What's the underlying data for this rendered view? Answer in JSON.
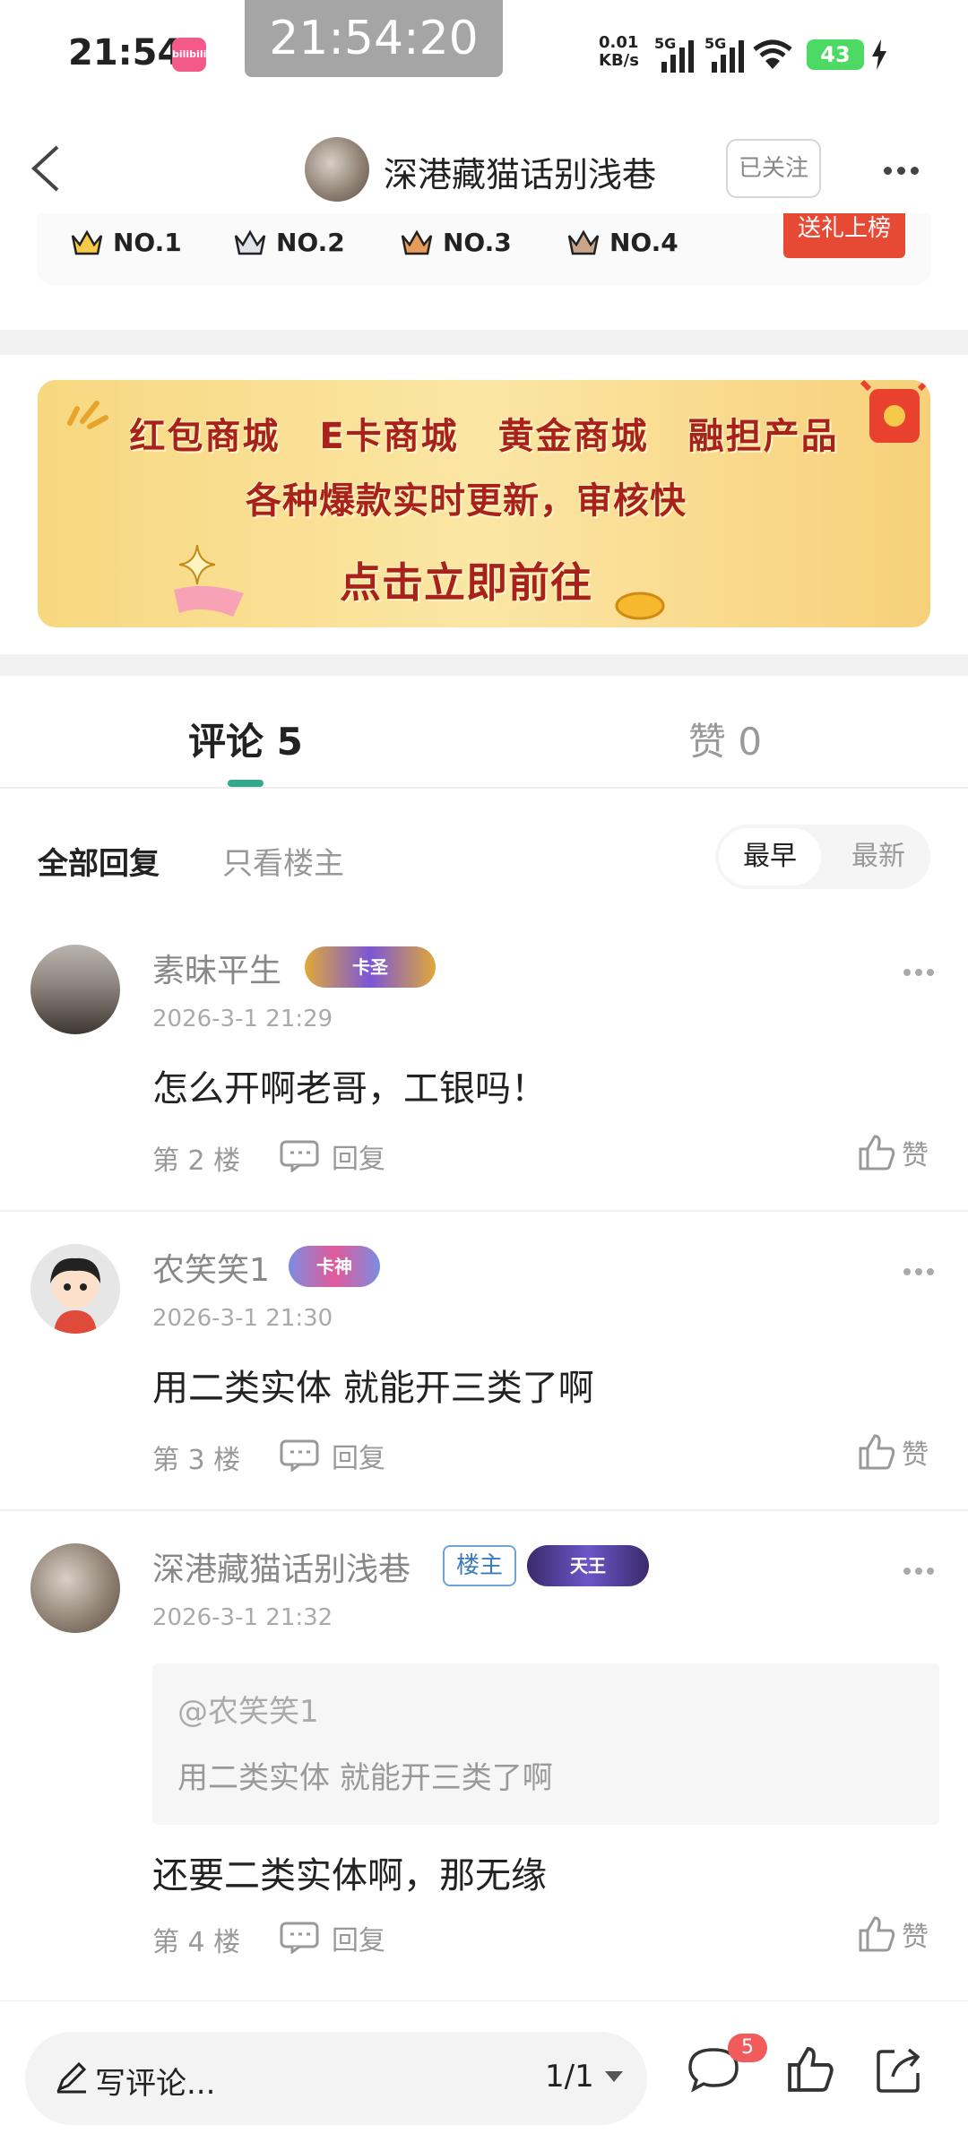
{
  "status_bar": {
    "time": "21:54",
    "app_icon_label": "bilibili",
    "overlay_clock": "21:54:20",
    "net_speed_value": "0.01",
    "net_speed_unit": "KB/s",
    "signal1_gen": "5G",
    "signal2_gen": "5G",
    "battery": "43"
  },
  "header": {
    "title": "深港藏猫话别浅巷",
    "follow_label": "已关注"
  },
  "ranking": {
    "items": [
      "NO.1",
      "NO.2",
      "NO.3",
      "NO.4"
    ],
    "gift_button": "送礼上榜"
  },
  "banner": {
    "row1": [
      "红包商城",
      "E卡商城",
      "黄金商城",
      "融担产品"
    ],
    "row2": "各种爆款实时更新，审核快",
    "row3": "点击立即前往"
  },
  "tabs": {
    "comments": "评论 5",
    "likes": "赞 0"
  },
  "filters": {
    "all": "全部回复",
    "op_only": "只看楼主",
    "sort_earliest": "最早",
    "sort_newest": "最新"
  },
  "comments": [
    {
      "name": "素昧平生",
      "badge": "卡圣",
      "time": "2026-3-1 21:29",
      "text": "怎么开啊老哥，工银吗！",
      "floor": "第 2 楼",
      "reply": "回复",
      "like": "赞"
    },
    {
      "name": "农笑笑1",
      "badge": "卡神",
      "time": "2026-3-1 21:30",
      "text": "用二类实体 就能开三类了啊",
      "floor": "第 3 楼",
      "reply": "回复",
      "like": "赞"
    },
    {
      "name": "深港藏猫话别浅巷",
      "op_tag": "楼主",
      "badge": "天王",
      "time": "2026-3-1 21:32",
      "quote_user": "@农笑笑1",
      "quote_text": "用二类实体 就能开三类了啊",
      "text": "还要二类实体啊，那无缘",
      "floor": "第 4 楼",
      "reply": "回复",
      "like": "赞"
    }
  ],
  "bottom_bar": {
    "write_placeholder": "写评论...",
    "page_indicator": "1/1",
    "comment_count_badge": "5"
  },
  "colors": {
    "accent_green": "#34a88c",
    "gift_red": "#e64a35",
    "badge_red": "#f25b5b",
    "banner_text": "#a8221a"
  }
}
